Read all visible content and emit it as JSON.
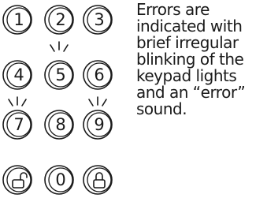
{
  "keypad": {
    "keys": [
      "1",
      "2",
      "3",
      "4",
      "5",
      "6",
      "7",
      "8",
      "9",
      "0"
    ],
    "icons": [
      "unlock-icon",
      "lock-icon"
    ],
    "blinking_keys": [
      "5",
      "7",
      "9"
    ]
  },
  "note": {
    "text": "Errors are indicated with brief irregular blinking of the keypad lights and an “error” sound."
  }
}
